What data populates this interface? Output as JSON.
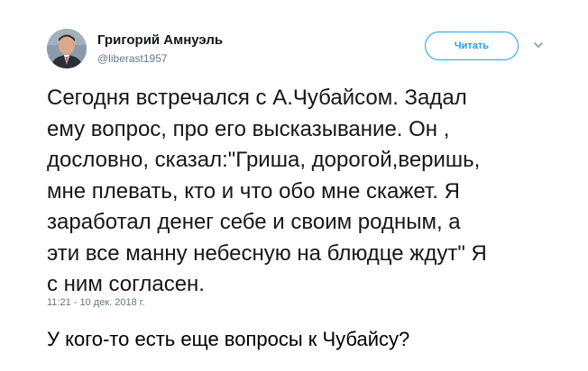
{
  "tweet": {
    "author_name": "Григорий Амнуэль",
    "author_handle": "@liberast1957",
    "follow_label": "Читать",
    "text_lines": [
      "Сегодня встречался с А.Чубайсом. Задал",
      "ему вопрос, про его высказывание. Он ,",
      "дословно, сказал:\"Гриша, дорогой,веришь,",
      "мне плевать, кто и что обо мне скажет. Я",
      "заработал денег себе и своим родным, а",
      "эти все манну небесную на блюдце ждут\" Я",
      "с ним согласен."
    ],
    "timestamp": "11:21 - 10 дек. 2018 г."
  },
  "caption": "У кого-то есть еще вопросы к Чубайсу?",
  "icons": {
    "avatar": "author-avatar",
    "caret": "chevron-down-icon"
  },
  "colors": {
    "accent": "#1da1f2",
    "text": "#14171a",
    "muted": "#657786"
  }
}
